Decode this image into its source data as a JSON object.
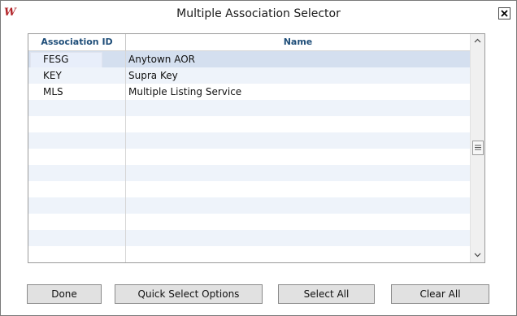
{
  "window": {
    "title": "Multiple Association Selector",
    "app_icon": "rms-logo-icon",
    "close_icon": "close-icon"
  },
  "grid": {
    "columns": [
      {
        "key": "id",
        "label": "Association ID"
      },
      {
        "key": "name",
        "label": "Name"
      }
    ],
    "rows": [
      {
        "id": "FESG",
        "name": "Anytown AOR",
        "selected": true
      },
      {
        "id": "KEY",
        "name": "Supra Key",
        "selected": false
      },
      {
        "id": "MLS",
        "name": "Multiple Listing Service",
        "selected": false
      }
    ],
    "empty_rows": 10,
    "scroll_up_icon": "chevron-up-icon",
    "scroll_down_icon": "chevron-down-icon",
    "scroll_thumb_icon": "grip-icon"
  },
  "buttons": {
    "done": "Done",
    "quick_select": "Quick Select Options",
    "select_all": "Select All",
    "clear_all": "Clear All"
  },
  "colors": {
    "header_text": "#1f4e79",
    "selected_row": "#d4dfef",
    "alt_row": "#eef3fa",
    "icon_red": "#b3262b"
  }
}
